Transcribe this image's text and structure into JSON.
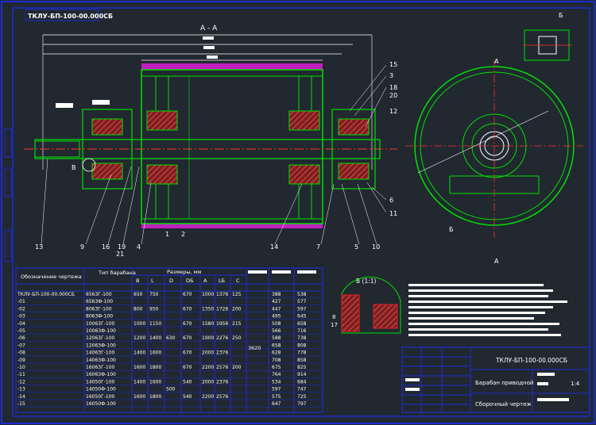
{
  "header_code": "ТКЛУ-БП-100-00.000СБ",
  "section_label": "А - А",
  "view_label": "Б",
  "detail_label": "В (1:1)",
  "callout_a": "А",
  "callout_b": "Б",
  "callout_v": "В",
  "part_numbers_right": [
    "15",
    "3",
    "18",
    "20",
    "12",
    "6",
    "11"
  ],
  "part_numbers_bottom": [
    "13",
    "9",
    "16",
    "19",
    "21",
    "4",
    "1",
    "2",
    "14",
    "7",
    "5",
    "10"
  ],
  "detail_numbers": [
    "8",
    "17"
  ],
  "table": {
    "header_designation": "Обозначение чертежа",
    "header_type": "Тип барабана",
    "header_sizes": "Размеры, мм",
    "columns": [
      "B",
      "L",
      "D",
      "DБ",
      "A",
      "LБ",
      "C"
    ],
    "rows": [
      {
        "code": "ТКЛУ-БП-100-00.000СБ",
        "type": "6563Г-100",
        "B": "650",
        "L": "750",
        "D": "",
        "Db": "670",
        "A": "1000",
        "Lb": "1376",
        "C": "125",
        "m1": "388",
        "m2": "538"
      },
      {
        "code": "-01",
        "type": "6563Ф-100",
        "B": "",
        "L": "",
        "D": "",
        "Db": "",
        "A": "",
        "Lb": "",
        "C": "",
        "m1": "427",
        "m2": "577"
      },
      {
        "code": "-02",
        "type": "8063Г-100",
        "B": "800",
        "L": "950",
        "D": "",
        "Db": "670",
        "A": "1350",
        "Lb": "1726",
        "C": "200",
        "m1": "447",
        "m2": "597"
      },
      {
        "code": "-03",
        "type": "8063Ф-100",
        "B": "",
        "L": "",
        "D": "",
        "Db": "",
        "A": "",
        "Lb": "",
        "C": "",
        "m1": "495",
        "m2": "645"
      },
      {
        "code": "-04",
        "type": "10063Г-100",
        "B": "1000",
        "L": "1150",
        "D": "",
        "Db": "670",
        "A": "1580",
        "Lb": "1956",
        "C": "215",
        "m1": "508",
        "m2": "658"
      },
      {
        "code": "-05",
        "type": "10063Ф-100",
        "B": "",
        "L": "",
        "D": "",
        "Db": "",
        "A": "",
        "Lb": "",
        "C": "",
        "m1": "566",
        "m2": "716"
      },
      {
        "code": "-06",
        "type": "12063Г-100",
        "B": "1200",
        "L": "1400",
        "D": "630",
        "Db": "670",
        "A": "1900",
        "Lb": "2276",
        "C": "250",
        "m1": "588",
        "m2": "738"
      },
      {
        "code": "-07",
        "type": "12063Ф-100",
        "B": "",
        "L": "",
        "D": "",
        "Db": "",
        "A": "",
        "Lb": "",
        "C": "",
        "m1": "658",
        "m2": "808"
      },
      {
        "code": "-08",
        "type": "14063Г-100",
        "B": "1400",
        "L": "1600",
        "D": "",
        "Db": "670",
        "A": "2000",
        "Lb": "2376",
        "C": "",
        "m1": "628",
        "m2": "778"
      },
      {
        "code": "-09",
        "type": "14063Ф-100",
        "B": "",
        "L": "",
        "D": "",
        "Db": "",
        "A": "",
        "Lb": "",
        "C": "",
        "m1": "708",
        "m2": "858"
      },
      {
        "code": "-10",
        "type": "16063Г-100",
        "B": "1600",
        "L": "1800",
        "D": "",
        "Db": "670",
        "A": "2200",
        "Lb": "2576",
        "C": "200",
        "m1": "675",
        "m2": "825"
      },
      {
        "code": "-11",
        "type": "16063Ф-100",
        "B": "",
        "L": "",
        "D": "",
        "Db": "",
        "A": "",
        "Lb": "",
        "C": "",
        "m1": "764",
        "m2": "914"
      },
      {
        "code": "-12",
        "type": "14050Г-100",
        "B": "1400",
        "L": "1600",
        "D": "",
        "Db": "540",
        "A": "2000",
        "Lb": "2376",
        "C": "",
        "m1": "534",
        "m2": "684"
      },
      {
        "code": "-13",
        "type": "14050Ф-100",
        "B": "",
        "L": "",
        "D": "500",
        "Db": "",
        "A": "",
        "Lb": "",
        "C": "",
        "m1": "597",
        "m2": "747"
      },
      {
        "code": "-14",
        "type": "16050Г-100",
        "B": "1600",
        "L": "1800",
        "D": "",
        "Db": "540",
        "A": "2200",
        "Lb": "2576",
        "C": "",
        "m1": "575",
        "m2": "725"
      },
      {
        "code": "-15",
        "type": "16050Ф-100",
        "B": "",
        "L": "",
        "D": "",
        "Db": "",
        "A": "",
        "Lb": "",
        "C": "",
        "m1": "647",
        "m2": "797"
      }
    ],
    "merged_value": "3620"
  },
  "title_block": {
    "code": "ТКЛУ-БП-100-00.000СБ",
    "name": "Барабан приводной",
    "doc_type": "Сборочный чертеж",
    "scale": "1:4"
  },
  "colors": {
    "background": "#212830",
    "frame": "#1e2bd0",
    "part": "#00e000",
    "section": "#e02020",
    "axis": "#ff3030",
    "magenta": "#c020c0",
    "white": "#ffffff"
  }
}
